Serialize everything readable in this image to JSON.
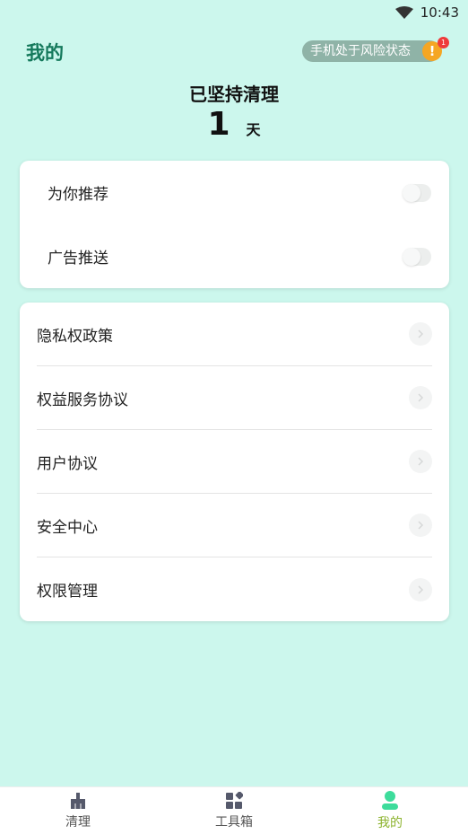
{
  "status_bar": {
    "time": "10:43"
  },
  "header": {
    "title": "我的",
    "risk_text": "手机处于风险状态",
    "risk_badge_count": "1",
    "risk_warn_glyph": "!"
  },
  "stats": {
    "label": "已坚持清理",
    "value": "1",
    "unit": "天"
  },
  "toggles": [
    {
      "label": "为你推荐",
      "on": false
    },
    {
      "label": "广告推送",
      "on": false
    }
  ],
  "links": [
    {
      "label": "隐私权政策"
    },
    {
      "label": "权益服务协议"
    },
    {
      "label": "用户协议"
    },
    {
      "label": "安全中心"
    },
    {
      "label": "权限管理"
    }
  ],
  "nav": {
    "items": [
      {
        "label": "清理",
        "icon": "broom-icon",
        "active": false
      },
      {
        "label": "工具箱",
        "icon": "toolbox-grid-icon",
        "active": false
      },
      {
        "label": "我的",
        "icon": "person-icon",
        "active": true
      }
    ],
    "active_color": "#8cb32e",
    "inactive_color": "#555555"
  },
  "colors": {
    "background": "#ccf7ed",
    "title_green": "#15795c",
    "warning_orange": "#f5a623",
    "badge_red": "#ef3b3b"
  }
}
